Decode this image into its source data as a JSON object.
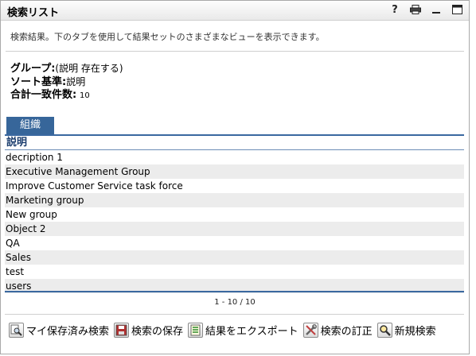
{
  "titlebar": {
    "title": "検索リスト",
    "icons": {
      "help": "?",
      "print": "print-icon",
      "minimize": "minimize-icon",
      "maximize": "maximize-icon"
    }
  },
  "description": "検索結果。下のタブを使用して結果セットのさまざまなビューを表示できます。",
  "meta": {
    "group_label": "グループ:",
    "group_value": "(説明 存在する)",
    "sort_label": "ソート基準:",
    "sort_value": "説明",
    "total_label": "合計一致件数:",
    "total_value": "10"
  },
  "tabs": [
    {
      "label": "組織",
      "selected": true
    }
  ],
  "table": {
    "header": "説明",
    "rows": [
      "decription 1",
      "Executive Management Group",
      "Improve Customer Service task force",
      "Marketing group",
      "New group",
      "Object 2",
      "QA",
      "Sales",
      "test",
      "users"
    ]
  },
  "pager": "1 - 10 / 10",
  "actions": [
    {
      "label": "マイ保存済み検索",
      "icon": "saved-searches-icon"
    },
    {
      "label": "検索の保存",
      "icon": "save-disk-icon"
    },
    {
      "label": "結果をエクスポート",
      "icon": "export-list-icon"
    },
    {
      "label": "検索の訂正",
      "icon": "refine-tools-icon"
    },
    {
      "label": "新規検索",
      "icon": "new-search-icon"
    }
  ],
  "colors": {
    "tab_bg": "#37669a",
    "header_text": "#1c3e6e",
    "row_alt": "#ececec",
    "rule": "#3a68a0"
  }
}
